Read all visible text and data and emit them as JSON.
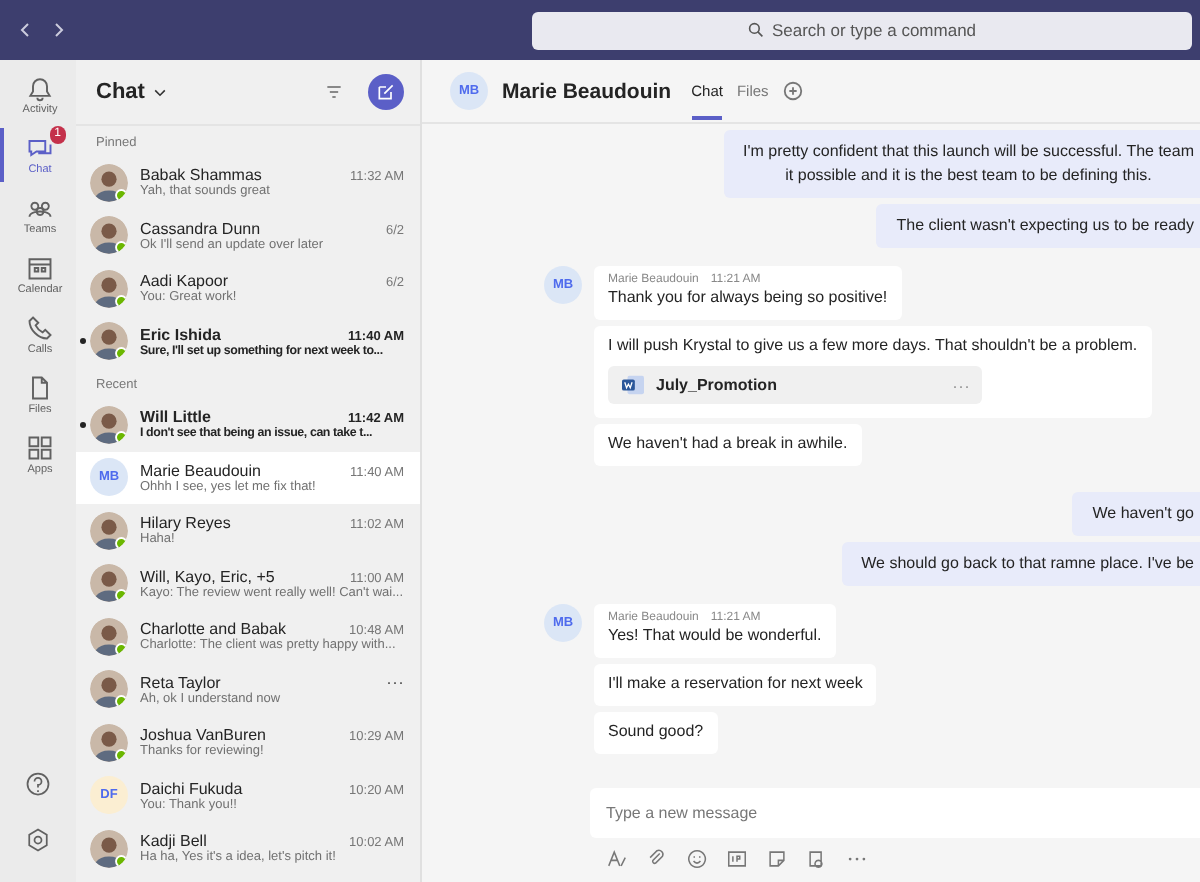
{
  "search": {
    "placeholder": "Search or type a command"
  },
  "rail": {
    "items": [
      {
        "label": "Activity",
        "selected": false
      },
      {
        "label": "Chat",
        "selected": true,
        "badge": "1"
      },
      {
        "label": "Teams",
        "selected": false
      },
      {
        "label": "Calendar",
        "selected": false
      },
      {
        "label": "Calls",
        "selected": false
      },
      {
        "label": "Files",
        "selected": false
      },
      {
        "label": "Apps",
        "selected": false
      }
    ]
  },
  "chat_list": {
    "title": "Chat",
    "sections": [
      {
        "label": "Pinned",
        "chats": [
          {
            "name": "Babak Shammas",
            "preview": "Yah, that sounds great",
            "time": "11:32 AM",
            "unread": false,
            "selected": false
          },
          {
            "name": "Cassandra Dunn",
            "preview": "Ok I'll send an update over later",
            "time": "6/2",
            "unread": false,
            "selected": false
          },
          {
            "name": "Aadi Kapoor",
            "preview": "You: Great work!",
            "time": "6/2",
            "unread": false,
            "selected": false
          },
          {
            "name": "Eric Ishida",
            "preview": "Sure, I'll set up something for next week to...",
            "time": "11:40 AM",
            "unread": true,
            "selected": false
          }
        ]
      },
      {
        "label": "Recent",
        "chats": [
          {
            "name": "Will Little",
            "preview": "I don't see that being an issue, can take t...",
            "time": "11:42 AM",
            "unread": true,
            "selected": false
          },
          {
            "name": "Marie Beaudouin",
            "preview": "Ohhh I see, yes let me fix that!",
            "time": "11:40 AM",
            "unread": false,
            "selected": true,
            "initials": "MB",
            "color": "#dbe6f6"
          },
          {
            "name": "Hilary Reyes",
            "preview": "Haha!",
            "time": "11:02 AM",
            "unread": false,
            "selected": false
          },
          {
            "name": "Will, Kayo, Eric, +5",
            "preview": "Kayo: The review went really well! Can't wai...",
            "time": "11:00 AM",
            "unread": false,
            "selected": false
          },
          {
            "name": "Charlotte and Babak",
            "preview": "Charlotte: The client was pretty happy with...",
            "time": "10:48 AM",
            "unread": false,
            "selected": false
          },
          {
            "name": "Reta Taylor",
            "preview": "Ah, ok I understand now",
            "more": "···",
            "unread": false,
            "selected": false
          },
          {
            "name": "Joshua VanBuren",
            "preview": "Thanks for reviewing!",
            "time": "10:29 AM",
            "unread": false,
            "selected": false
          },
          {
            "name": "Daichi Fukuda",
            "preview": "You: Thank you!!",
            "time": "10:20 AM",
            "unread": false,
            "selected": false,
            "initials": "DF",
            "color": "#fbeed2"
          },
          {
            "name": "Kadji Bell",
            "preview": "Ha ha, Yes it's a idea, let's pitch it!",
            "time": "10:02 AM",
            "unread": false,
            "selected": false
          }
        ]
      }
    ]
  },
  "conversation": {
    "initials": "MB",
    "name": "Marie Beaudouin",
    "tabs": [
      {
        "label": "Chat",
        "selected": true
      },
      {
        "label": "Files",
        "selected": false
      }
    ],
    "messages": [
      {
        "kind": "sent",
        "lines": [
          "I'm pretty confident that this launch will be successful. The team",
          "it possible and it is the best team to be defining this."
        ]
      },
      {
        "kind": "sent",
        "lines": [
          "The client wasn't expecting us to be ready"
        ]
      },
      {
        "kind": "received",
        "initials": "MB",
        "sender": "Marie Beaudouin",
        "time": "11:21 AM",
        "bubbles": [
          {
            "text": "Thank you for always being so positive!"
          },
          {
            "text": "I will push Krystal to give us a few more days. That shouldn't be a problem.",
            "attachment": {
              "name": "July_Promotion",
              "more": "···"
            }
          },
          {
            "text": "We haven't had a break in awhile."
          }
        ]
      },
      {
        "kind": "sent",
        "lines": [
          "We haven't go"
        ]
      },
      {
        "kind": "sent",
        "lines": [
          "We should go back to that ramne place. I've be"
        ]
      },
      {
        "kind": "received",
        "initials": "MB",
        "sender": "Marie Beaudouin",
        "time": "11:21 AM",
        "bubbles": [
          {
            "text": "Yes! That would be wonderful."
          },
          {
            "text": "I'll make a reservation for next week"
          },
          {
            "text": "Sound good?"
          }
        ]
      }
    ],
    "compose": {
      "placeholder": "Type a new message"
    }
  }
}
